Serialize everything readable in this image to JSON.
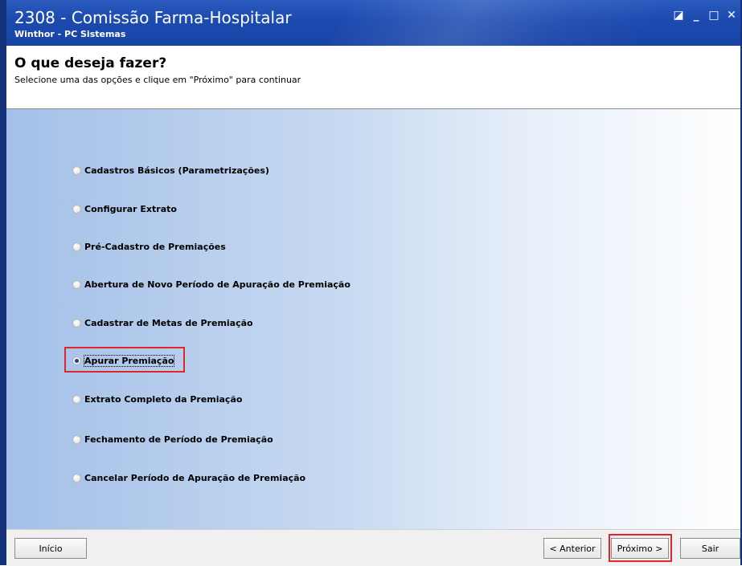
{
  "window": {
    "title": "2308 - Comissão Farma-Hospitalar",
    "subtitle": "Winthor - PC Sistemas",
    "controls": {
      "restore": "◪",
      "minimize": "_",
      "maximize": "□",
      "close": "✕"
    }
  },
  "header": {
    "title": "O que deseja fazer?",
    "description": "Selecione uma das opções e clique em \"Próximo\" para continuar"
  },
  "options": [
    {
      "label": "Cadastros Básicos (Parametrizações)",
      "selected": false
    },
    {
      "label": "Configurar Extrato",
      "selected": false
    },
    {
      "label": "Pré-Cadastro de Premiações",
      "selected": false
    },
    {
      "label": "Abertura de Novo Período de Apuração de Premiação",
      "selected": false
    },
    {
      "label": "Cadastrar de Metas de Premiação",
      "selected": false
    },
    {
      "label": "Apurar Premiação",
      "selected": true
    },
    {
      "label": "Extrato Completo da Premiação",
      "selected": false
    },
    {
      "label": "Fechamento de Período de Premiação",
      "selected": false
    },
    {
      "label": "Cancelar Período de Apuração de  Premiação",
      "selected": false
    }
  ],
  "footer": {
    "inicio": "Início",
    "anterior": "< Anterior",
    "proximo": "Próximo >",
    "sair": "Sair"
  },
  "colors": {
    "titlebar": "#1c4ab0",
    "highlight": "#e0262b",
    "content_gradient_start": "#a4c0e8"
  }
}
